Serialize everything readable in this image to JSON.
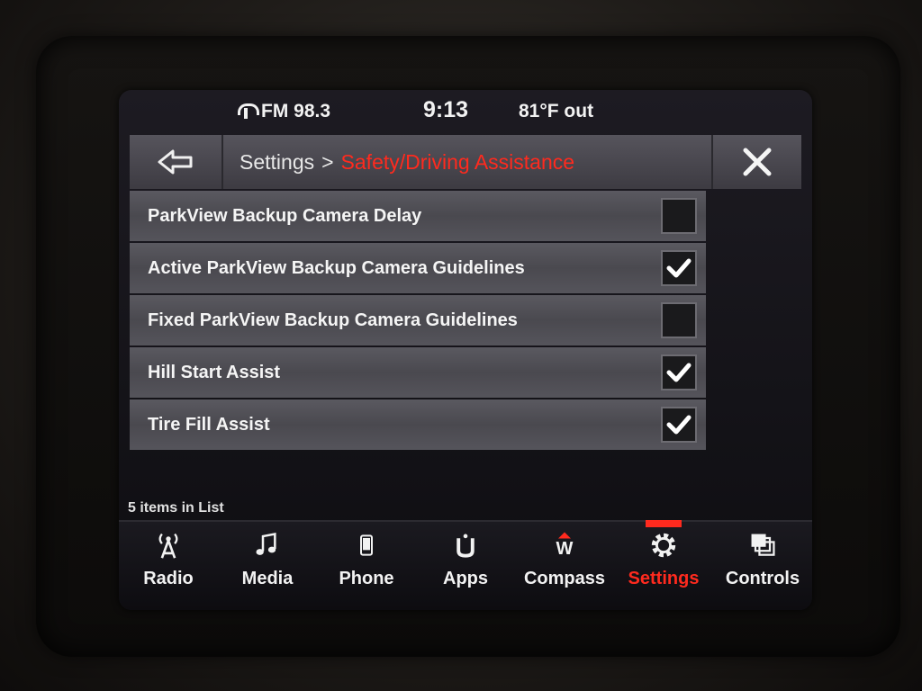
{
  "status": {
    "radio": "FM 98.3",
    "time": "9:13",
    "temperature": "81°F out"
  },
  "header": {
    "breadcrumb_root": "Settings",
    "separator": ">",
    "breadcrumb_current": "Safety/Driving Assistance",
    "accent_color": "#ff2a1e"
  },
  "list": {
    "items": [
      {
        "label": "ParkView Backup Camera Delay",
        "checked": false
      },
      {
        "label": "Active ParkView Backup Camera Guidelines",
        "checked": true
      },
      {
        "label": "Fixed ParkView Backup Camera Guidelines",
        "checked": false
      },
      {
        "label": "Hill Start Assist",
        "checked": true
      },
      {
        "label": "Tire Fill Assist",
        "checked": true
      }
    ],
    "count_text": "5 items in List"
  },
  "nav": {
    "items": [
      {
        "label": "Radio",
        "icon": "antenna-icon",
        "active": false
      },
      {
        "label": "Media",
        "icon": "music-note-icon",
        "active": false
      },
      {
        "label": "Phone",
        "icon": "phone-icon",
        "active": false
      },
      {
        "label": "Apps",
        "icon": "apps-icon",
        "active": false
      },
      {
        "label": "Compass",
        "icon": "compass-icon",
        "active": false
      },
      {
        "label": "Settings",
        "icon": "gear-icon",
        "active": true
      },
      {
        "label": "Controls",
        "icon": "controls-icon",
        "active": false
      }
    ],
    "compass_heading": "W"
  }
}
